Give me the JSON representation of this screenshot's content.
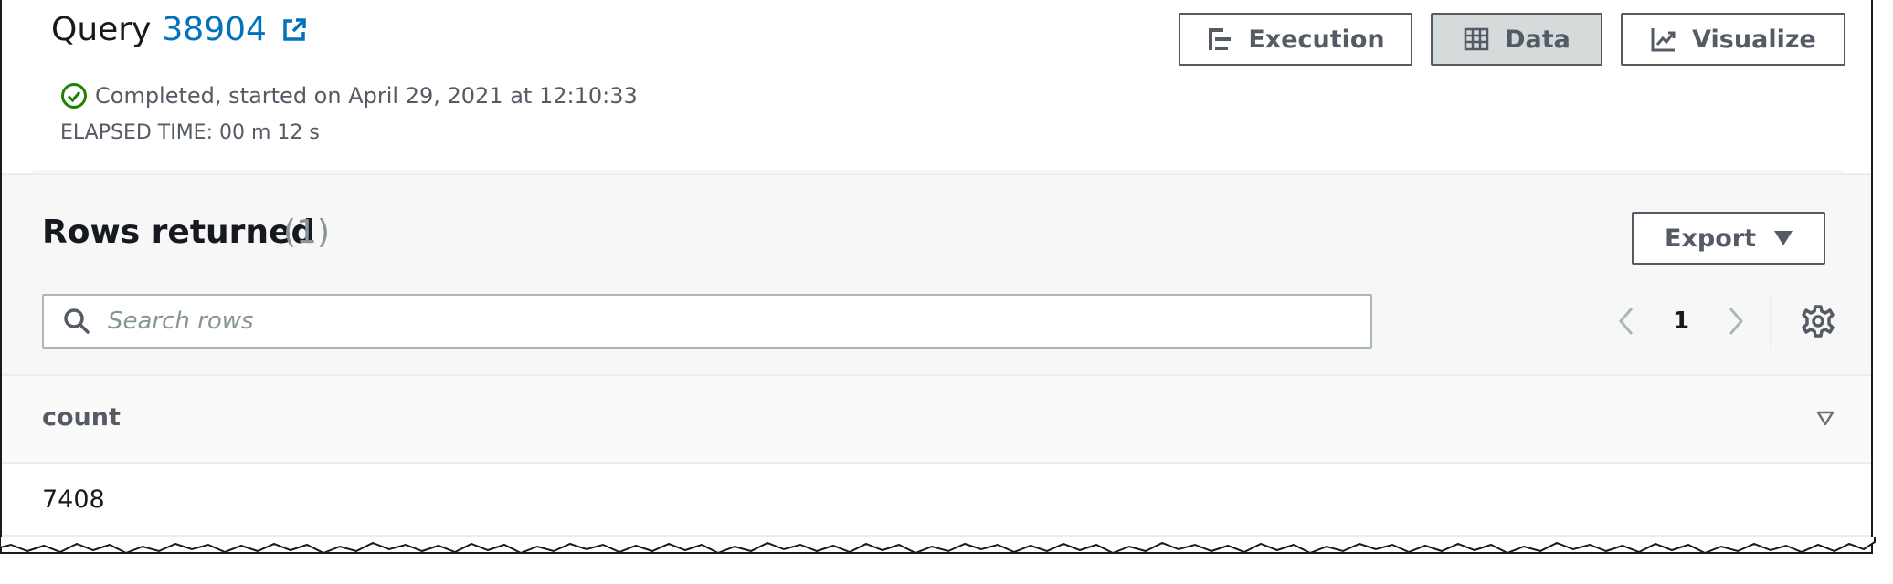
{
  "query": {
    "label": "Query",
    "id": "38904",
    "status_text": "Completed, started on April 29, 2021 at 12:10:33",
    "elapsed_text": "ELAPSED TIME: 00 m 12 s"
  },
  "view_toggle": {
    "execution_label": "Execution",
    "data_label": "Data",
    "visualize_label": "Visualize",
    "active": "Data"
  },
  "results": {
    "title": "Rows returned",
    "count_text": "(1)",
    "export_label": "Export",
    "search_placeholder": "Search rows",
    "current_page": "1"
  },
  "table": {
    "columns": [
      "count"
    ],
    "rows": [
      [
        "7408"
      ]
    ]
  },
  "colors": {
    "link": "#0073bb",
    "success": "#1d8102",
    "text": "#16191f",
    "muted": "#545b64",
    "active_button_bg": "#d5dbdb"
  },
  "icons": {
    "external_link": "external-link-icon",
    "status": "check-circle-icon",
    "execution": "execution-icon",
    "data": "table-icon",
    "visualize": "chart-icon",
    "search": "search-icon",
    "prev": "chevron-left-icon",
    "next": "chevron-right-icon",
    "settings": "gear-icon",
    "sort": "sort-triangle-icon"
  }
}
